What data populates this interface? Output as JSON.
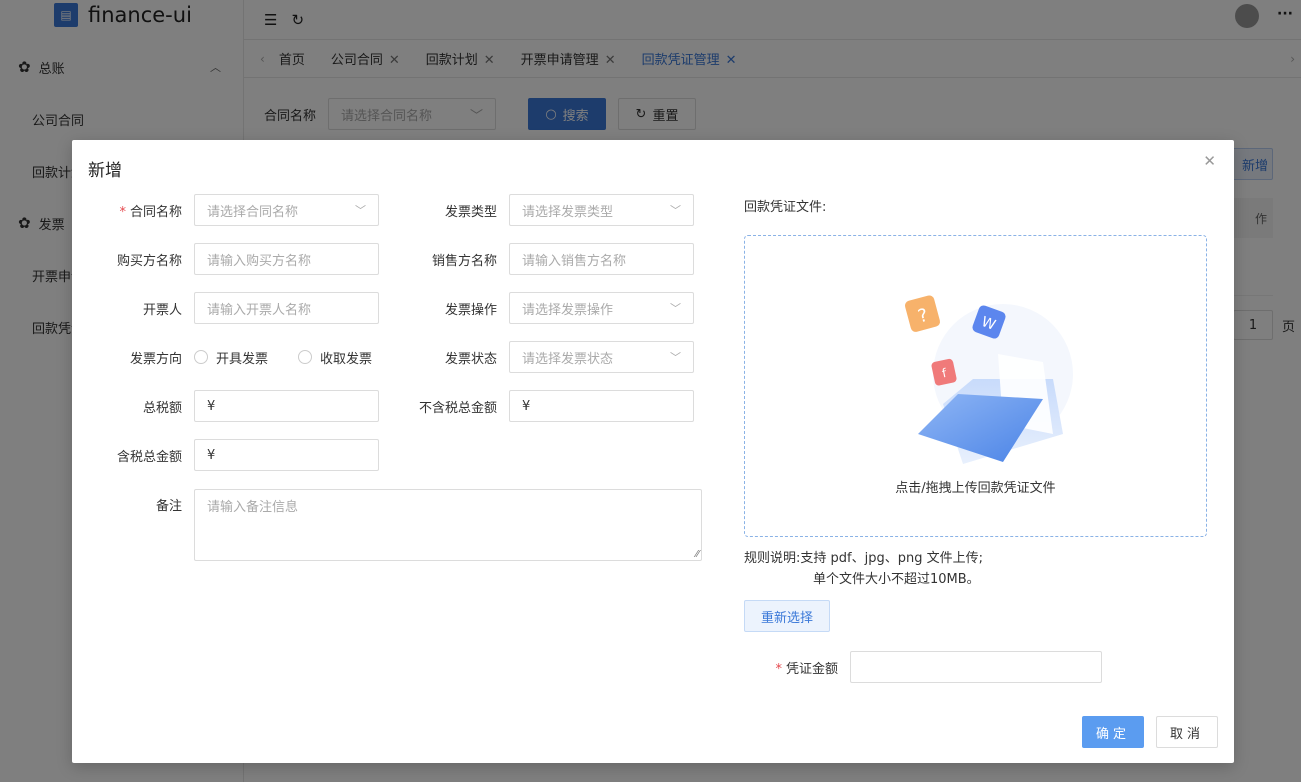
{
  "app": {
    "logo_text": "finance-ui"
  },
  "sidebar": {
    "groups": [
      {
        "label": "总账",
        "items": [
          "公司合同",
          "回款计划"
        ]
      },
      {
        "label": "发票",
        "items": [
          "开票申请管理",
          "回款凭证管理"
        ]
      }
    ]
  },
  "tabs": [
    "首页",
    "公司合同",
    "回款计划",
    "开票申请管理",
    "回款凭证管理"
  ],
  "active_tab_index": 4,
  "background_page": {
    "filter_label": "合同名称",
    "filter_placeholder": "请选择合同名称",
    "search_label": "搜索",
    "reset_label": "重置",
    "add_label": "新增",
    "table_header_fragment": "作",
    "page_number": "1",
    "page_suffix": "页"
  },
  "modal": {
    "title": "新增",
    "left": {
      "contract_name": {
        "label": "合同名称",
        "placeholder": "请选择合同名称"
      },
      "buyer_name": {
        "label": "购买方名称",
        "placeholder": "请输入购买方名称"
      },
      "drawer": {
        "label": "开票人",
        "placeholder": "请输入开票人名称"
      },
      "invoice_direction": {
        "label": "发票方向",
        "options": [
          "开具发票",
          "收取发票"
        ]
      },
      "total_tax": {
        "label": "总税额",
        "value": "¥"
      },
      "total_with_tax": {
        "label": "含税总金额",
        "value": "¥"
      },
      "remark": {
        "label": "备注",
        "placeholder": "请输入备注信息"
      }
    },
    "right": {
      "invoice_type": {
        "label": "发票类型",
        "placeholder": "请选择发票类型"
      },
      "seller_name": {
        "label": "销售方名称",
        "placeholder": "请输入销售方名称"
      },
      "invoice_operation": {
        "label": "发票操作",
        "placeholder": "请选择发票操作"
      },
      "invoice_status": {
        "label": "发票状态",
        "placeholder": "请选择发票状态"
      },
      "total_without_tax": {
        "label": "不含税总金额",
        "value": "¥"
      }
    },
    "upload": {
      "label": "回款凭证文件:",
      "drop_text": "点击/拖拽上传回款凭证文件",
      "rule_line1": "规则说明:支持 pdf、jpg、png 文件上传;",
      "rule_line2": "单个文件大小不超过10MB。",
      "reselect_label": "重新选择",
      "amount_label": "凭证金额"
    },
    "ok_label": "确定",
    "cancel_label": "取消"
  },
  "colors": {
    "primary": "#3a78d8",
    "required": "#e5484d",
    "overlay": "rgba(0,0,0,0.5)"
  }
}
